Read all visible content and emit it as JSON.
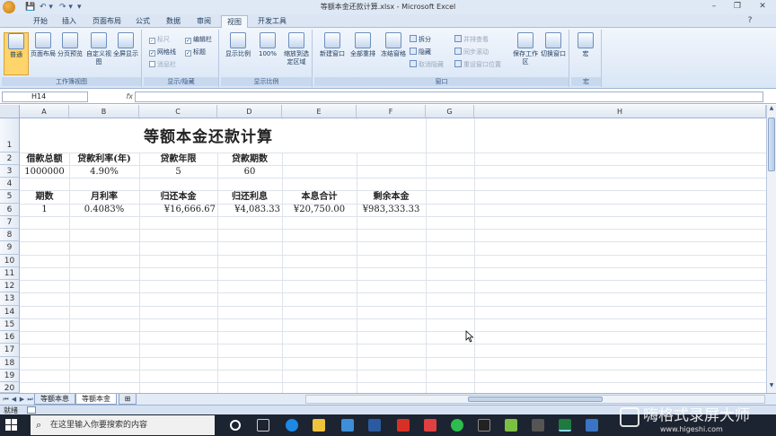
{
  "window": {
    "title": "等额本金还款计算.xlsx - Microsoft Excel",
    "qat": [
      "💾",
      "↶ ▾",
      "↷ ▾",
      "▾"
    ]
  },
  "tabs": [
    "开始",
    "插入",
    "页面布局",
    "公式",
    "数据",
    "审阅",
    "视图",
    "开发工具"
  ],
  "active_tab": "视图",
  "ribbon": {
    "groups": [
      {
        "label": "工作簿视图",
        "buttons": [
          "普通",
          "页面布局",
          "分页预览",
          "自定义视图",
          "全屏显示"
        ]
      },
      {
        "label": "显示/隐藏",
        "checks": [
          {
            "label": "标尺",
            "checked": true,
            "disabled": true
          },
          {
            "label": "网格线",
            "checked": true
          },
          {
            "label": "消息栏",
            "checked": false,
            "disabled": true
          },
          {
            "label": "编辑栏",
            "checked": true
          },
          {
            "label": "标题",
            "checked": true
          }
        ]
      },
      {
        "label": "显示比例",
        "buttons": [
          "显示比例",
          "100%",
          "缩放到选定区域"
        ]
      },
      {
        "label": "窗口",
        "buttons": [
          "新建窗口",
          "全部重排",
          "冻结窗格"
        ],
        "small": [
          "拆分",
          "隐藏",
          "取消隐藏",
          "并排查看",
          "同步滚动",
          "重设窗口位置"
        ],
        "big2": [
          "保存工作区",
          "切换窗口"
        ]
      },
      {
        "label": "宏",
        "buttons": [
          "宏"
        ]
      }
    ]
  },
  "formula_bar": {
    "name_box": "H14",
    "fx": "fx",
    "formula": ""
  },
  "sheet": {
    "columns": [
      "A",
      "B",
      "C",
      "D",
      "E",
      "F",
      "G",
      "H"
    ],
    "rows": [
      "1",
      "2",
      "3",
      "4",
      "5",
      "6",
      "7",
      "8",
      "9",
      "10",
      "11",
      "12",
      "13",
      "14",
      "15",
      "16",
      "17",
      "18",
      "19",
      "20"
    ],
    "title": "等额本金还款计算",
    "header_row1": [
      "借款总额",
      "贷款利率(年)",
      "贷款年限",
      "贷款期数"
    ],
    "values_row1": [
      "1000000",
      "4.90%",
      "5",
      "60"
    ],
    "header_row2": [
      "期数",
      "月利率",
      "归还本金",
      "归还利息",
      "本息合计",
      "剩余本金"
    ],
    "values_row2": [
      "1",
      "0.4083%",
      "¥16,666.67",
      "¥4,083.33",
      "¥20,750.00",
      "¥983,333.33"
    ]
  },
  "sheet_tabs": [
    "等额本息",
    "等额本金"
  ],
  "active_sheet": "等额本金",
  "status": "就绪",
  "taskbar": {
    "search_placeholder": "在这里输入你要搜索的内容"
  },
  "watermark": {
    "text": "嗨格式录屏大师",
    "url": "www.higeshi.com"
  }
}
